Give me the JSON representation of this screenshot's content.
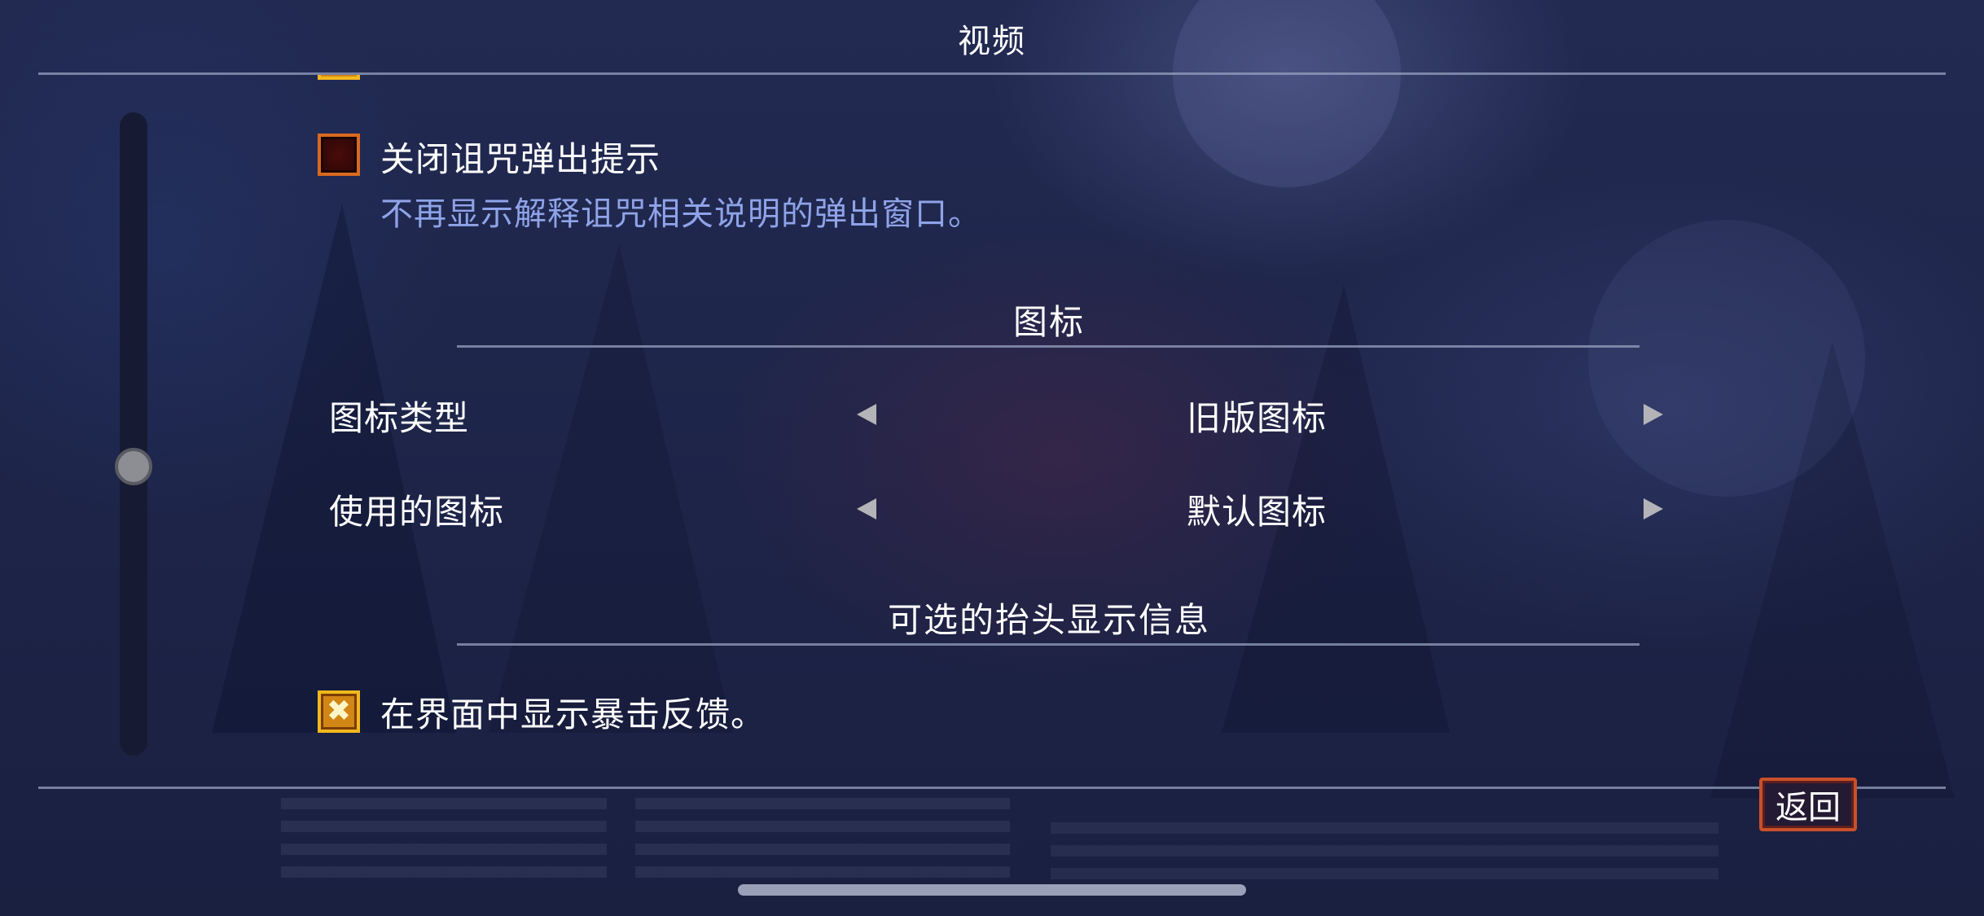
{
  "header": {
    "title": "视频"
  },
  "options": {
    "close_curse_popup": {
      "label": "关闭诅咒弹出提示",
      "description": "不再显示解释诅咒相关说明的弹出窗口。",
      "checked": false
    },
    "show_crit_feedback": {
      "label": "在界面中显示暴击反馈。",
      "checked": true,
      "check_glyph": "✖"
    }
  },
  "sections": {
    "icons": {
      "title": "图标",
      "rows": [
        {
          "label": "图标类型",
          "value": "旧版图标"
        },
        {
          "label": "使用的图标",
          "value": "默认图标"
        }
      ]
    },
    "hud": {
      "title": "可选的抬头显示信息"
    }
  },
  "footer": {
    "back_label": "返回"
  },
  "icons": {
    "left_arrow": "triangle-left-icon",
    "right_arrow": "triangle-right-icon"
  },
  "colors": {
    "accent_orange": "#d9691f",
    "accent_gold": "#f3b81e",
    "desc_blue": "#8fa3e8",
    "back_border": "#c9502a"
  }
}
